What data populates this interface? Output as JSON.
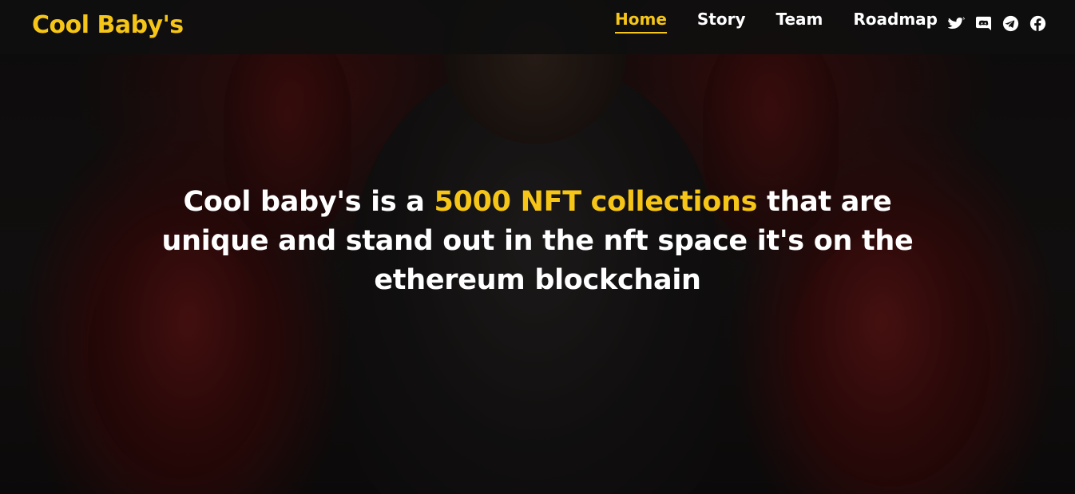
{
  "colors": {
    "accent": "#f5c518",
    "text": "#ffffff",
    "nav_bg": "#0f0f0f"
  },
  "brand": {
    "name": "Cool Baby's"
  },
  "nav": {
    "items": [
      {
        "label": "Home",
        "active": true
      },
      {
        "label": "Story",
        "active": false
      },
      {
        "label": "Team",
        "active": false
      },
      {
        "label": "Roadmap",
        "active": false
      }
    ]
  },
  "socials": [
    {
      "icon": "twitter-icon"
    },
    {
      "icon": "discord-icon"
    },
    {
      "icon": "telegram-icon"
    },
    {
      "icon": "facebook-icon"
    }
  ],
  "hero": {
    "text_before": "Cool baby's is a ",
    "highlight": "5000 NFT collections",
    "text_after": " that are unique and stand out in the nft space it's on the ethereum blockchain"
  }
}
